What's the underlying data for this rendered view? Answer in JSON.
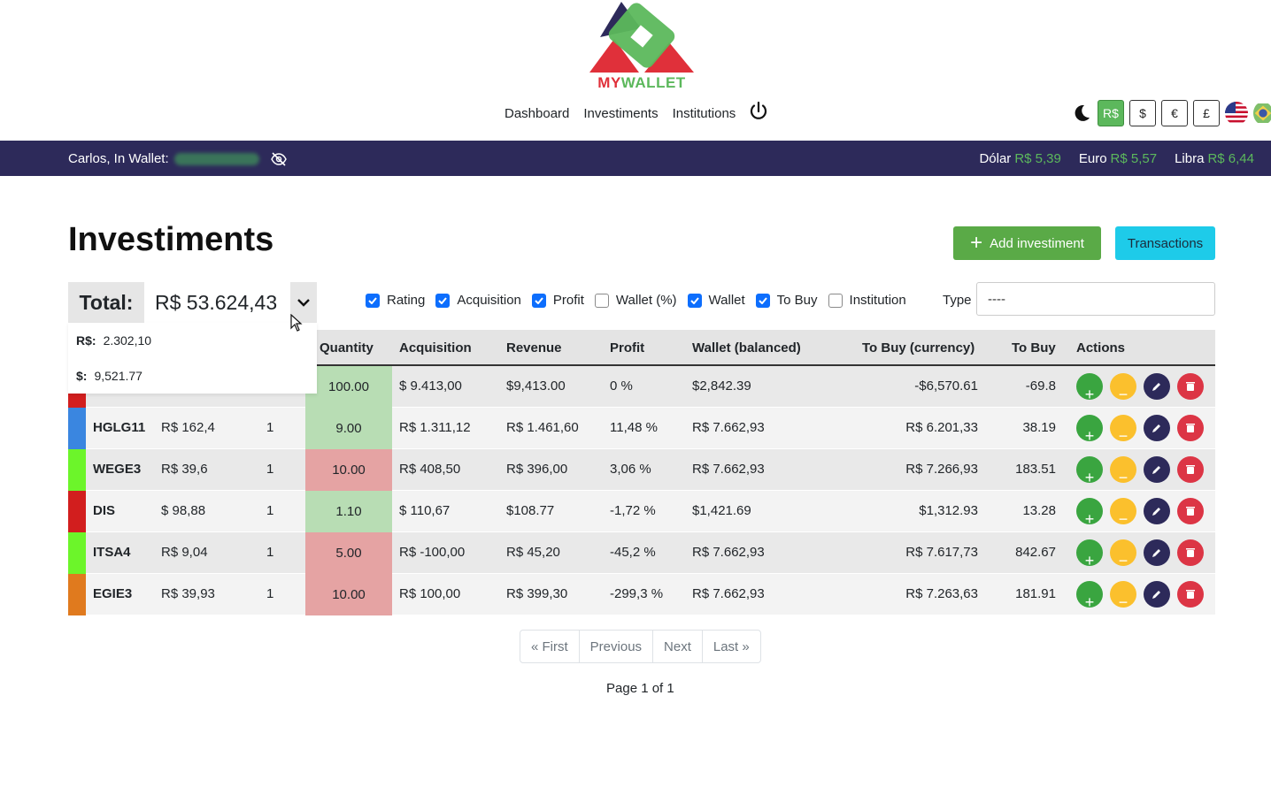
{
  "brand": {
    "name_part1": "MY",
    "name_part2": "WALLET"
  },
  "nav": {
    "items": [
      "Dashboard",
      "Investiments",
      "Institutions"
    ]
  },
  "currency_buttons": [
    "R$",
    "$",
    "€",
    "£"
  ],
  "active_currency": "R$",
  "band": {
    "greeting": "Carlos, In Wallet:",
    "rates": [
      {
        "label": "Dólar",
        "value": "R$ 5,39"
      },
      {
        "label": "Euro",
        "value": "R$ 5,57"
      },
      {
        "label": "Libra",
        "value": "R$ 6,44"
      }
    ]
  },
  "page": {
    "title": "Investiments",
    "add_button": "Add investiment",
    "transactions_button": "Transactions"
  },
  "total": {
    "label": "Total:",
    "value": "R$ 53.624,43",
    "breakdown": [
      {
        "label": "R$:",
        "value": "2.302,10"
      },
      {
        "label": "$:",
        "value": "9,521.77"
      }
    ]
  },
  "filters": [
    {
      "label": "Rating",
      "checked": true
    },
    {
      "label": "Acquisition",
      "checked": true
    },
    {
      "label": "Profit",
      "checked": true
    },
    {
      "label": "Wallet (%)",
      "checked": false
    },
    {
      "label": "Wallet",
      "checked": true
    },
    {
      "label": "To Buy",
      "checked": true
    },
    {
      "label": "Institution",
      "checked": false
    }
  ],
  "type_filter": {
    "label": "Type",
    "value": "----"
  },
  "table": {
    "headers": [
      "Quantity",
      "Acquisition",
      "Revenue",
      "Profit",
      "Wallet (balanced)",
      "To Buy (currency)",
      "To Buy",
      "Actions"
    ],
    "rows": [
      {
        "color": "#d21e1e",
        "ticker": "",
        "price": "",
        "rating": "",
        "quantity": "100.00",
        "qty_state": "green",
        "acquisition": "$ 9.413,00",
        "revenue": "$9,413.00",
        "profit": "0 %",
        "wallet": "$2,842.39",
        "to_buy_currency": "-$6,570.61",
        "to_buy": "-69.8"
      },
      {
        "color": "#3a86e0",
        "ticker": "HGLG11",
        "price": "R$ 162,4",
        "rating": "1",
        "quantity": "9.00",
        "qty_state": "green",
        "acquisition": "R$ 1.311,12",
        "revenue": "R$ 1.461,60",
        "profit": "11,48 %",
        "wallet": "R$ 7.662,93",
        "to_buy_currency": "R$ 6.201,33",
        "to_buy": "38.19"
      },
      {
        "color": "#6cf52a",
        "ticker": "WEGE3",
        "price": "R$ 39,6",
        "rating": "1",
        "quantity": "10.00",
        "qty_state": "red",
        "acquisition": "R$ 408,50",
        "revenue": "R$ 396,00",
        "profit": "3,06 %",
        "wallet": "R$ 7.662,93",
        "to_buy_currency": "R$ 7.266,93",
        "to_buy": "183.51"
      },
      {
        "color": "#d21e1e",
        "ticker": "DIS",
        "price": "$ 98,88",
        "rating": "1",
        "quantity": "1.10",
        "qty_state": "green",
        "acquisition": "$ 110,67",
        "revenue": "$108.77",
        "profit": "-1,72 %",
        "wallet": "$1,421.69",
        "to_buy_currency": "$1,312.93",
        "to_buy": "13.28"
      },
      {
        "color": "#6cf52a",
        "ticker": "ITSA4",
        "price": "R$ 9,04",
        "rating": "1",
        "quantity": "5.00",
        "qty_state": "red",
        "acquisition": "R$ -100,00",
        "revenue": "R$ 45,20",
        "profit": "-45,2 %",
        "wallet": "R$ 7.662,93",
        "to_buy_currency": "R$ 7.617,73",
        "to_buy": "842.67"
      },
      {
        "color": "#e07a1e",
        "ticker": "EGIE3",
        "price": "R$ 39,93",
        "rating": "1",
        "quantity": "10.00",
        "qty_state": "red",
        "acquisition": "R$ 100,00",
        "revenue": "R$ 399,30",
        "profit": "-299,3 %",
        "wallet": "R$ 7.662,93",
        "to_buy_currency": "R$ 7.263,63",
        "to_buy": "181.91"
      }
    ]
  },
  "pagination": {
    "buttons": [
      "« First",
      "Previous",
      "Next",
      "Last »"
    ],
    "info": "Page 1 of 1"
  }
}
